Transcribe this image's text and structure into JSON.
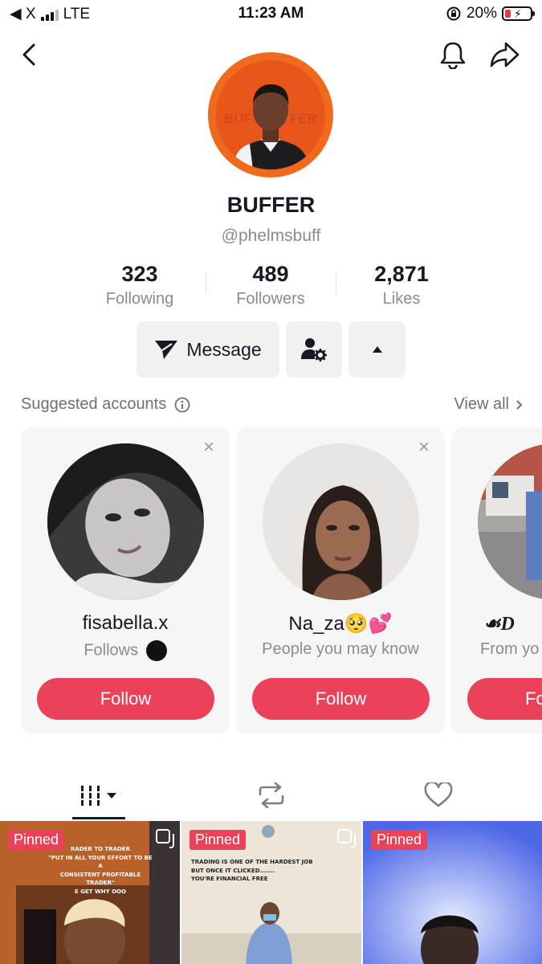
{
  "status_bar": {
    "carrier_back": "◀ X",
    "network": "LTE",
    "time": "11:23 AM",
    "battery": "20%",
    "battery_color": "#e53935"
  },
  "header": {
    "back_icon": "chevron-left-icon",
    "bell_icon": "bell-icon",
    "share_icon": "share-arrow-icon"
  },
  "profile": {
    "avatar_text_left": "BUF",
    "avatar_text_right": "FER",
    "name": "BUFFER",
    "handle": "@phelmsbuff",
    "stats": [
      {
        "value": "323",
        "label": "Following"
      },
      {
        "value": "489",
        "label": "Followers"
      },
      {
        "value": "2,871",
        "label": "Likes"
      }
    ],
    "message_label": "Message"
  },
  "suggested": {
    "title": "Suggested accounts",
    "view_all": "View all",
    "accounts": [
      {
        "name": "fisabella.x",
        "sub": "Follows",
        "follow_label": "Follow"
      },
      {
        "name": "Na_za🥺💕",
        "sub": "People you may know",
        "follow_label": "Follow"
      },
      {
        "name": "☙D",
        "sub": "From yo",
        "follow_label": "Fo"
      }
    ]
  },
  "tabs": {
    "videos_icon": "grid-icon",
    "reposts_icon": "repost-icon",
    "liked_icon": "heart-icon"
  },
  "videos": [
    {
      "badge": "Pinned",
      "text_lines": [
        "RADER TO TRADER",
        "\"PUT IN ALL YOUR EFFORT TO BE A",
        "CONSISTENT PROFITABLE TRADER\"",
        "",
        "E GET WHY OOO"
      ]
    },
    {
      "badge": "Pinned",
      "text_lines": [
        "TRADING IS ONE OF THE HARDEST JOB",
        "BUT ONCE IT CLICKED.......",
        "",
        "YOU'RE FINANCIAL FREE"
      ]
    },
    {
      "badge": "Pinned",
      "text_lines": []
    }
  ],
  "colors": {
    "accent": "#ea4359",
    "avatar_ring": "#f06a1d",
    "muted_text": "#8a8b91"
  }
}
